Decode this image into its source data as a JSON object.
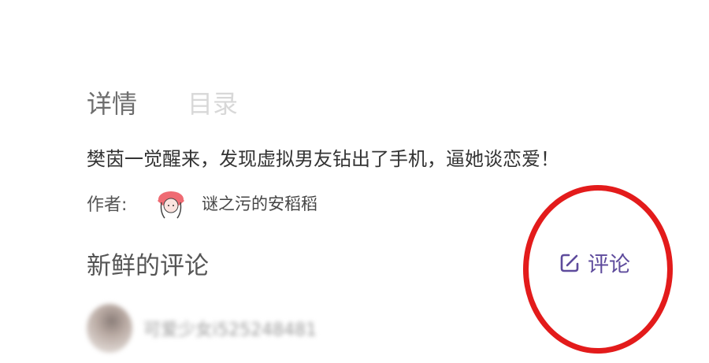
{
  "tabs": {
    "detail_label": "详情",
    "toc_label": "目录"
  },
  "story": {
    "title": "樊茵一觉醒来，发现虚拟男友钻出了手机，逼她谈恋爱！"
  },
  "author": {
    "label": "作者:",
    "name": "谜之污的安稻稻"
  },
  "comments": {
    "section_title": "新鲜的评论",
    "action_label": "评论",
    "first_user": "可爱少女i525248481"
  },
  "colors": {
    "accent": "#5e4b9c",
    "annotation_circle": "#e31b1b"
  },
  "icons": {
    "comment_action": "edit-icon",
    "author_avatar": "avatar-icon"
  }
}
